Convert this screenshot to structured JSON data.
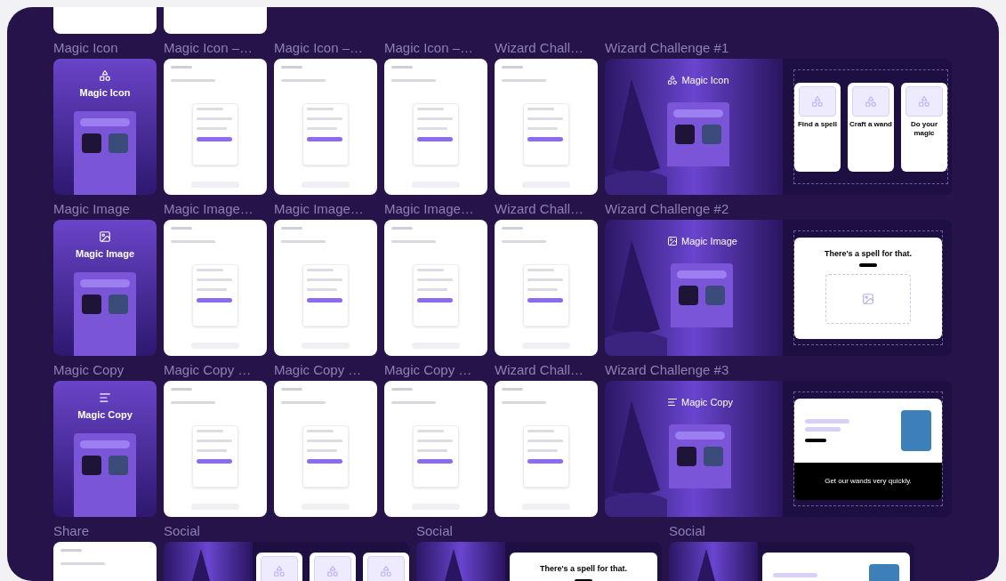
{
  "rows": [
    {
      "frames": [
        {
          "label": "Magic Icon",
          "kind": "cover",
          "title": "Magic Icon"
        },
        {
          "label": "Magic Icon –…",
          "kind": "screen"
        },
        {
          "label": "Magic Icon –…",
          "kind": "screen"
        },
        {
          "label": "Magic Icon –…",
          "kind": "screen"
        },
        {
          "label": "Wizard Chall…",
          "kind": "screen"
        },
        {
          "label": "Wizard Challenge #1",
          "kind": "challenge",
          "title": "Magic Icon",
          "content": {
            "kind": "cards",
            "cards": [
              "Find a spell",
              "Craft a wand",
              "Do your magic"
            ]
          }
        }
      ]
    },
    {
      "frames": [
        {
          "label": "Magic Image",
          "kind": "cover",
          "title": "Magic Image"
        },
        {
          "label": "Magic Image…",
          "kind": "screen"
        },
        {
          "label": "Magic Image…",
          "kind": "screen"
        },
        {
          "label": "Magic Image…",
          "kind": "screen"
        },
        {
          "label": "Wizard Chall…",
          "kind": "screen"
        },
        {
          "label": "Wizard Challenge #2",
          "kind": "challenge",
          "title": "Magic Image",
          "content": {
            "kind": "landing",
            "headline": "There's a spell for that."
          }
        }
      ]
    },
    {
      "frames": [
        {
          "label": "Magic Copy",
          "kind": "cover",
          "title": "Magic Copy"
        },
        {
          "label": "Magic Copy …",
          "kind": "screen"
        },
        {
          "label": "Magic Copy …",
          "kind": "screen"
        },
        {
          "label": "Magic Copy …",
          "kind": "screen"
        },
        {
          "label": "Wizard Chall…",
          "kind": "screen"
        },
        {
          "label": "Wizard Challenge #3",
          "kind": "challenge",
          "title": "Magic Copy",
          "content": {
            "kind": "hero",
            "headline": "Get our wands very quickly."
          }
        }
      ]
    },
    {
      "frames": [
        {
          "label": "Share",
          "kind": "screen"
        },
        {
          "label": "Social",
          "kind": "social",
          "content": {
            "kind": "cards"
          }
        },
        {
          "label": "Social",
          "kind": "social",
          "content": {
            "kind": "landing",
            "headline": "There's a spell for that."
          }
        },
        {
          "label": "Social",
          "kind": "social",
          "content": {
            "kind": "hero"
          }
        }
      ]
    }
  ]
}
